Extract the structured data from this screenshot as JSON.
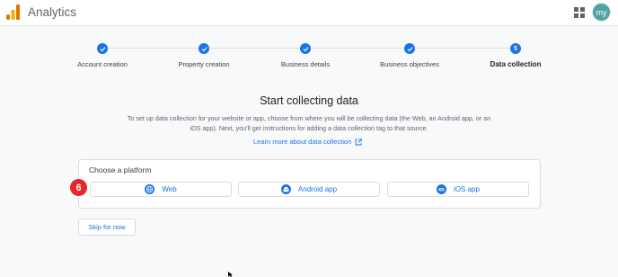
{
  "app": {
    "title": "Analytics",
    "avatar_initials": "my"
  },
  "colors": {
    "accent": "#1a73e8",
    "badge": "#e8252c",
    "avatar": "#4fa3a5"
  },
  "stepper": {
    "steps": [
      {
        "label": "Account creation",
        "state": "done"
      },
      {
        "label": "Property creation",
        "state": "done"
      },
      {
        "label": "Business details",
        "state": "done"
      },
      {
        "label": "Business objectives",
        "state": "done"
      },
      {
        "label": "Data collection",
        "state": "current",
        "number": "5"
      }
    ]
  },
  "main": {
    "heading": "Start collecting data",
    "description": "To set up data collection for your website or app, choose from where you will be collecting data (the Web, an Android app, or an iOS app). Next, you'll get instructions for adding a data collection tag to that source.",
    "learn_more": "Learn more about data collection"
  },
  "platform_card": {
    "title": "Choose a platform",
    "badge": "6",
    "options": [
      {
        "label": "Web",
        "icon": "globe-icon"
      },
      {
        "label": "Android app",
        "icon": "android-icon"
      },
      {
        "label": "iOS app",
        "icon": "ios-icon"
      }
    ]
  },
  "skip_label": "Skip for now"
}
